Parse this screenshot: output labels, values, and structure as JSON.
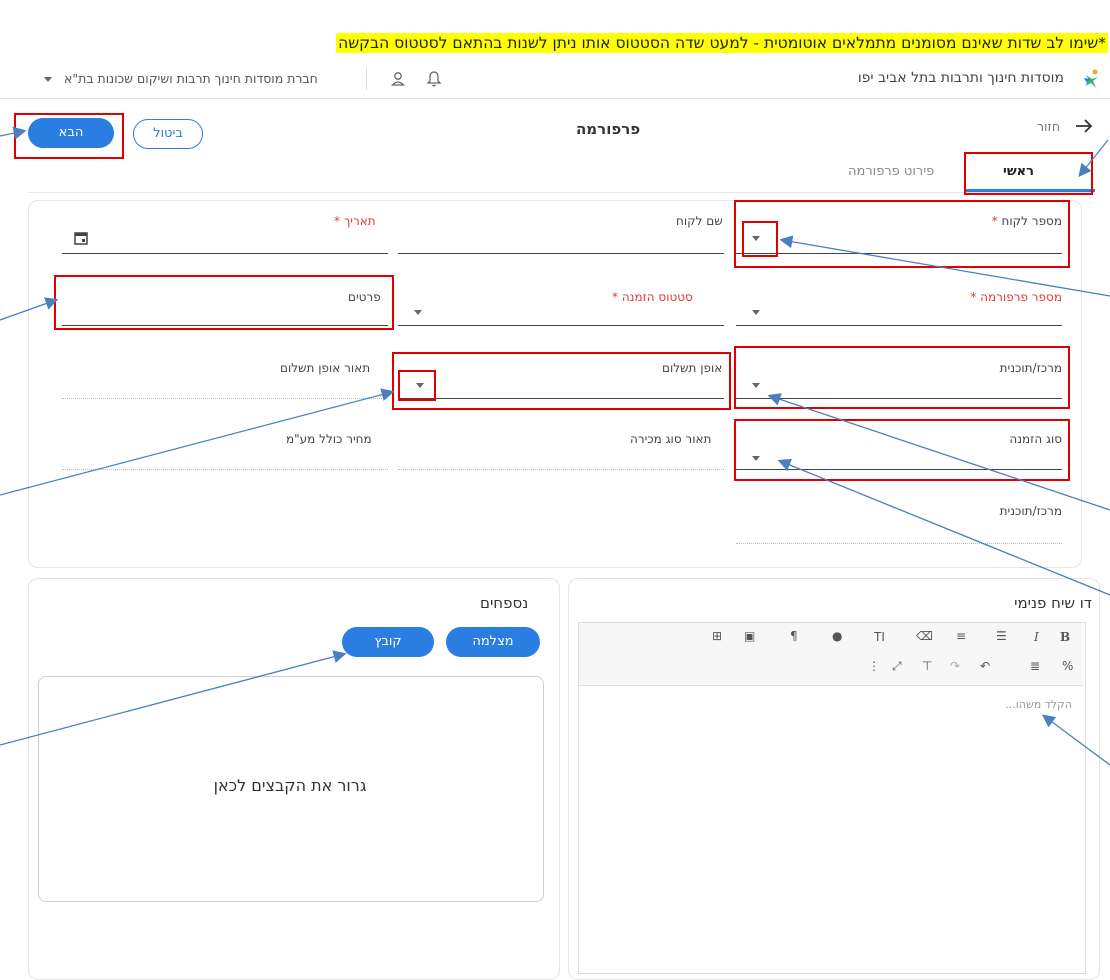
{
  "note": "*שימו לב שדות שאינם מסומנים מתמלאים אוטומטית - למעט שדה הסטטוס אותו ניתן לשנות בהתאם לסטטוס הבקשה",
  "topbar": {
    "app_title": "מוסדות חינוך ותרבות בתל אביב יפו",
    "org_name": "חברת מוסדות חינוך תרבות ושיקום שכונות בת\"א"
  },
  "header": {
    "back_label": "חזור",
    "page_title": "פרפורמה",
    "next_label": "הבא",
    "cancel_label": "ביטול"
  },
  "tabs": [
    {
      "label": "ראשי",
      "active": true
    },
    {
      "label": "פירוט פרפורמה",
      "active": false
    }
  ],
  "form": {
    "customer_number": "מספר לקוח",
    "customer_name": "שם לקוח",
    "date": "תאריך",
    "proforma_number": "מספר פרפורמה",
    "order_status": "סטטוס הזמנה",
    "details": "פרטים",
    "center_program": "מרכז/תוכנית",
    "payment_method": "אופן תשלום",
    "payment_method_desc": "תאור אופן תשלום",
    "order_type": "סוג הזמנה",
    "sale_type_desc": "תאור סוג מכירה",
    "price_incl_vat": "מחיר כולל מע\"מ",
    "center_program_2": "מרכז/תוכנית",
    "required_mark": "*"
  },
  "internal_chat": {
    "title": "דו שיח פנימי",
    "placeholder": "הקלד משהו..."
  },
  "attachments": {
    "title": "נספחים",
    "camera_label": "מצלמה",
    "file_label": "קובץ",
    "drop_text": "גרור את הקבצים לכאן"
  },
  "colors": {
    "accent": "#2a7de1",
    "highlight": "#ffff00",
    "annotation_red": "#e00000",
    "arrow_blue": "#4a7fc1"
  }
}
